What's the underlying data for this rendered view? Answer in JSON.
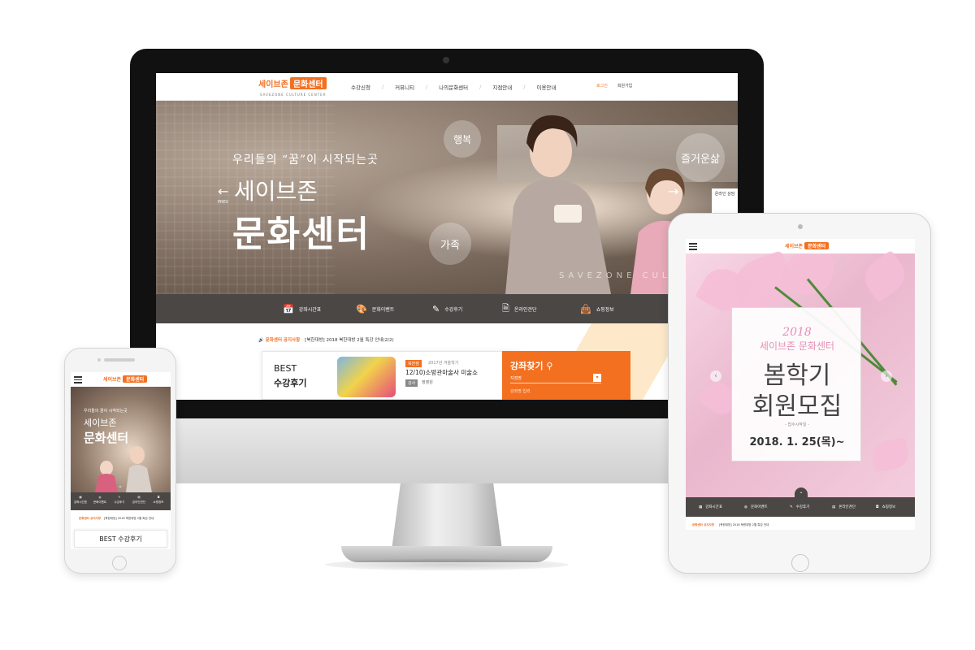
{
  "desktop": {
    "logo": {
      "part1": "세이브존",
      "part2": "문화센터",
      "sub": "SAVEZONE CULTURE CENTER"
    },
    "nav": [
      "수강신청",
      "커뮤니티",
      "나의문화센터",
      "지점안내",
      "이용안내"
    ],
    "util": {
      "login": "로그인",
      "join": "회원가입"
    },
    "hero": {
      "subtitle": "우리들의 “꿈”이 시작되는곳",
      "title1": "세이브존",
      "title2": "문화센터",
      "bubble_happy": "행복",
      "bubble_fun": "즐거운삶",
      "bubble_family": "가족",
      "watermark": "SAVEZONE CULTU",
      "prev_label": "PREV",
      "side_tab": "온라인 상담"
    },
    "quick_menu": [
      {
        "icon": "calendar-icon",
        "glyph": "📅",
        "label": "강좌시간표"
      },
      {
        "icon": "palette-icon",
        "glyph": "🎨",
        "label": "문화이벤트"
      },
      {
        "icon": "pencil-icon",
        "glyph": "✎",
        "label": "수강후기"
      },
      {
        "icon": "document-icon",
        "glyph": "🗎",
        "label": "온라인견단"
      },
      {
        "icon": "bag-icon",
        "glyph": "👜",
        "label": "쇼핑정보"
      }
    ],
    "notice": {
      "title": "문화센터 공지사항",
      "text": "[북한대방] 2018 북한대방 2월 특강 안내(2/2)"
    },
    "best": {
      "word1": "BEST",
      "word2": "수강후기",
      "badge": "북한점",
      "category": "2017년 겨울학기",
      "title": "12/10)소방관마술사 미술쇼",
      "tag": "강사",
      "name": "정영원"
    },
    "search": {
      "title": "강좌찾기",
      "select": "지점명",
      "input": "강좌명 입력"
    }
  },
  "phone": {
    "logo": {
      "part1": "세이브존",
      "part2": "문화센터"
    },
    "hero": {
      "subtitle": "우리들의 꿈이 시작되는곳",
      "title1": "세이브존",
      "title2": "문화센터"
    },
    "quick_menu": [
      "강좌시간표",
      "문화이벤트",
      "수강후기",
      "온라인견단",
      "쇼핑정보"
    ],
    "notice": {
      "title": "문화센터 공지사항",
      "text": "[북한대방] 2018 북한대방 2월 특강 안내"
    },
    "best": "BEST 수강후기"
  },
  "tablet": {
    "logo": {
      "part1": "세이브존",
      "part2": "문화센터"
    },
    "hero": {
      "year": "2018",
      "center": "세이브존 문화센터",
      "line1": "봄학기",
      "line2": "회원모집",
      "small": "- 접수시작일 -",
      "date": "2018. 1. 25(목)~"
    },
    "quick_menu": [
      "강좌시간표",
      "문화이벤트",
      "수강후기",
      "온라인견단",
      "쇼핑정보"
    ],
    "notice": {
      "title": "문화센터 공지사항",
      "text": "[북한대방] 2018 북한대방 2월 특강 안내"
    }
  },
  "colors": {
    "accent": "#f37021",
    "dark_bar": "#4a4745",
    "pink": "#e38fb3"
  }
}
